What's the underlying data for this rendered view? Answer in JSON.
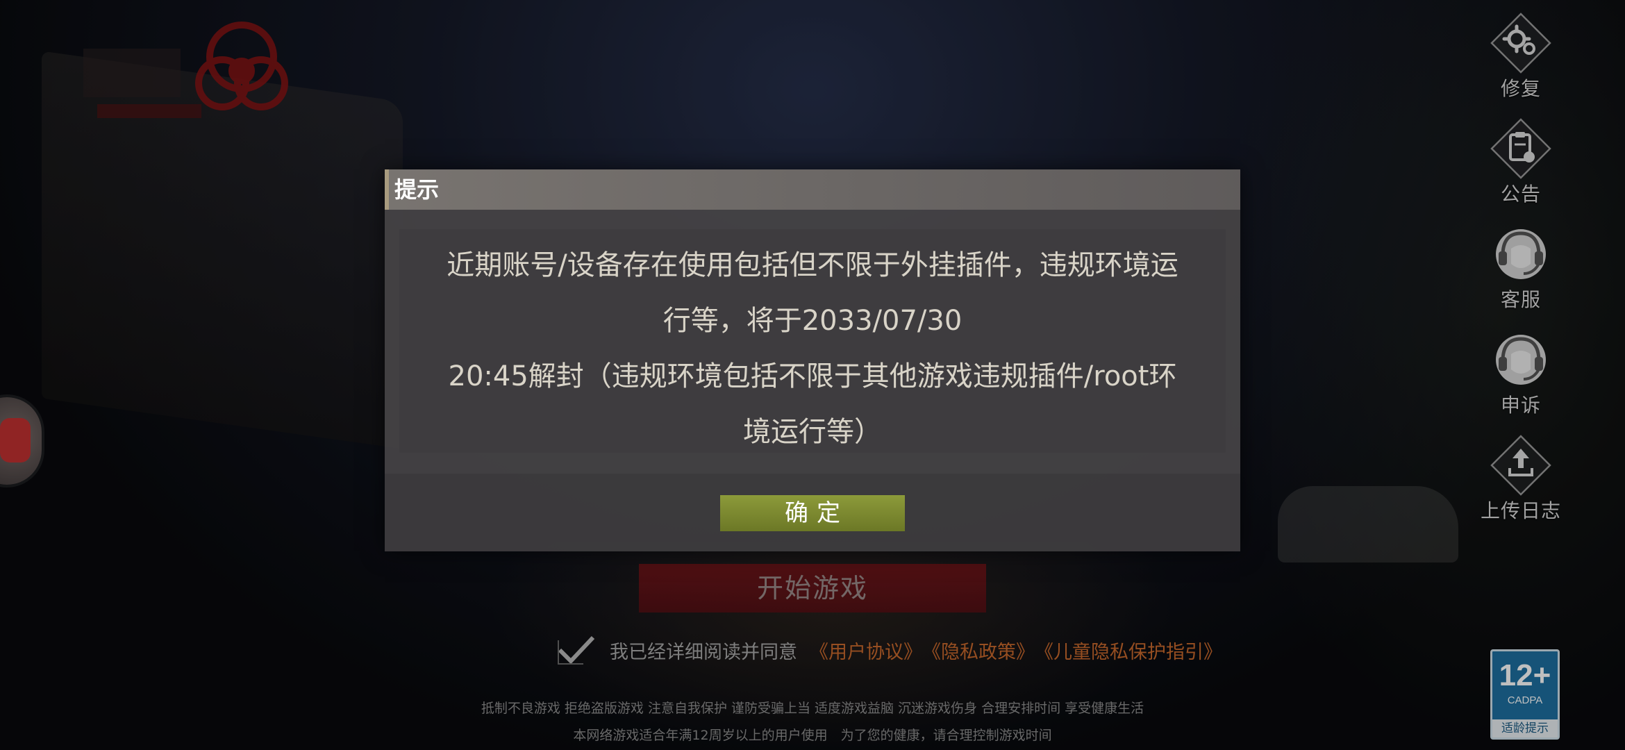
{
  "side_menu": [
    {
      "id": "repair",
      "label": "修复",
      "icon": "gear-icon"
    },
    {
      "id": "announcement",
      "label": "公告",
      "icon": "clipboard-icon"
    },
    {
      "id": "customer-service",
      "label": "客服",
      "icon": "headset-icon"
    },
    {
      "id": "appeal",
      "label": "申诉",
      "icon": "headset-icon"
    },
    {
      "id": "upload-log",
      "label": "上传日志",
      "icon": "upload-icon"
    }
  ],
  "start_button": {
    "label": "开始游戏"
  },
  "agreement": {
    "text": "我已经详细阅读并同意",
    "user_agreement": "《用户协议》",
    "privacy_policy": "《隐私政策》",
    "child_privacy": "《儿童隐私保护指引》"
  },
  "notice": {
    "line1": "抵制不良游戏 拒绝盗版游戏 注意自我保护 谨防受骗上当 适度游戏益脑 沉迷游戏伤身 合理安排时间 享受健康生活",
    "line2": "本网络游戏适合年满12周岁以上的用户使用　为了您的健康，请合理控制游戏时间"
  },
  "age_rating": {
    "rating": "12+",
    "org": "CADPA",
    "caption": "适龄提示",
    "color": "#1e6fa0"
  },
  "dialog": {
    "title": "提示",
    "message_line1": "近期账号/设备存在使用包括但不限于外挂插件，违规环境运",
    "message_line2": "行等，将于2033/07/30",
    "message_line3": "20:45解封（违规环境包括不限于其他游戏违规插件/root环",
    "message_line4": "境运行等）",
    "confirm_label": "确定",
    "confirm_color": "#7d8a30"
  }
}
